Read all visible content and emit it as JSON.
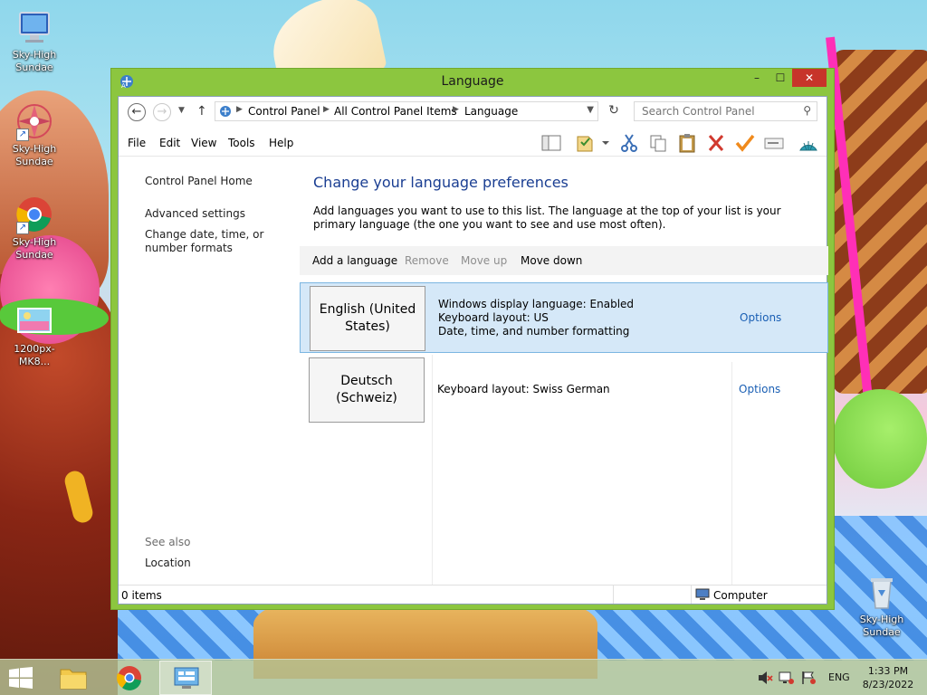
{
  "desktop": {
    "icons": [
      {
        "label": "Sky-High Sundae"
      },
      {
        "label": "Sky-High Sundae"
      },
      {
        "label": "Sky-High Sundae"
      },
      {
        "label": "1200px-MK8..."
      },
      {
        "label": "Sky-High Sundae"
      }
    ]
  },
  "window": {
    "title": "Language",
    "controls": {
      "minimize": "–",
      "maximize": "☐",
      "close": "✕"
    }
  },
  "nav": {
    "breadcrumbs": [
      "Control Panel",
      "All Control Panel Items",
      "Language"
    ],
    "search_placeholder": "Search Control Panel"
  },
  "menu": {
    "items": [
      "File",
      "Edit",
      "View",
      "Tools",
      "Help"
    ]
  },
  "toolbar": {
    "icons": [
      "layout-pane-icon",
      "properties-icon",
      "cut-icon",
      "copy-icon",
      "paste-icon",
      "delete-icon",
      "check-icon",
      "rename-icon",
      "shell-icon"
    ]
  },
  "left_pane": {
    "home": "Control Panel Home",
    "links": [
      "Advanced settings",
      "Change date, time, or number formats"
    ],
    "see_also": "See also",
    "location": "Location"
  },
  "main": {
    "heading": "Change your language preferences",
    "intro": "Add languages you want to use to this list. The language at the top of your list is your primary language (the one you want to see and use most often).",
    "commands": {
      "add": "Add a language",
      "remove": "Remove",
      "move_up": "Move up",
      "move_down": "Move down"
    },
    "languages": [
      {
        "name": "English (United States)",
        "details": [
          "Windows display language: Enabled",
          "Keyboard layout: US",
          "Date, time, and number formatting"
        ],
        "options": "Options",
        "selected": true
      },
      {
        "name": "Deutsch (Schweiz)",
        "details": [
          "Keyboard layout: Swiss German"
        ],
        "options": "Options",
        "selected": false
      }
    ]
  },
  "statusbar": {
    "items": "0 items",
    "location": "Computer"
  },
  "taskbar": {
    "input_language": "ENG",
    "time": "1:33 PM",
    "date": "8/23/2022"
  },
  "colors": {
    "window_frame": "#8cc63f",
    "close_button": "#c7342a",
    "heading": "#1a3e92",
    "link": "#1a5fb4",
    "selection": "#d5e8f8"
  }
}
